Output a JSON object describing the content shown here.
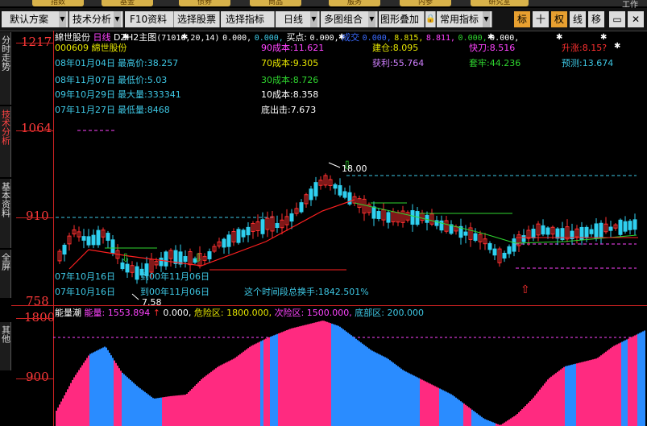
{
  "top_menu": [
    "指数",
    "基金",
    "债券",
    "商品",
    "服务",
    "内参",
    "研究室"
  ],
  "top_right_text": "工作",
  "toolbar": {
    "buttons": [
      "默认方案",
      "技术分析",
      "F10资料",
      "选择股票",
      "选择指标",
      "日线",
      "多图组合",
      "图形叠加",
      "常用指标"
    ],
    "icons": [
      "标",
      "十",
      "权",
      "线",
      "移"
    ]
  },
  "sidebar": [
    "分时走势",
    "技术分析",
    "基本资料",
    "全屏",
    "其他"
  ],
  "price_axis": {
    "labels": [
      "1217",
      "1064",
      "910",
      "758"
    ]
  },
  "vol_axis": {
    "labels": [
      "1800",
      "900"
    ]
  },
  "chart_header": {
    "stock": "綿世股份",
    "period": "日线",
    "main": "DZH2主图",
    "params": "(71016,20,14)",
    "v1": "0.000,",
    "v2": "0.000,",
    "buy_label": "买点:",
    "v3": "0.000,",
    "mid_label": "成交",
    "v4": "0.000,",
    "v5": "8.815,",
    "v6": "8.811,",
    "v7": "0.000,",
    "v8": "0.000,"
  },
  "info_left": {
    "code_name": "000609 綿世股份",
    "high_date": "08年01月04日",
    "high": "最高价:38.257",
    "low_date": "08年11月07日",
    "low": "最低价:5.03",
    "maxvol_date": "09年10月29日",
    "maxvol": "最大量:333341",
    "minvol_date": "07年11月27日",
    "minvol": "最低量:8468"
  },
  "info_mid": {
    "c90": "90成本:11.621",
    "c70": "70成本:9.305",
    "c30": "30成本:8.726",
    "c10": "10成本:8.358",
    "bottom": "底出击:7.673"
  },
  "info_right": {
    "jiancang": "建仓:8.095",
    "kuaidao": "快刀:8.516",
    "shengzhang": "升涨:8.15?",
    "huoli": "获利:55.764",
    "taolao": "套牢:44.236",
    "yuce": "预测:13.674"
  },
  "annotations": {
    "peak": "18.00",
    "low": "7.58",
    "start1": "07年10月16日",
    "end1": "到00年11月06日",
    "start2": "07年10月16日",
    "end2": "到00年11月06日",
    "turnover": "这个时间段总换手:1842.501%"
  },
  "volume_header": {
    "name": "能量潮",
    "energy": "能量: 1553.894",
    "arrow": "↑",
    "v": "0.000,",
    "danger": "危险区: 1800.000,",
    "sub_danger": "次险区: 1500.000,",
    "bottom": "底部区: 200.000"
  },
  "colors": {
    "up": "#ff3030",
    "down": "#2fd0f0",
    "vol_up": "#ff2a80",
    "vol_down": "#2a8cff",
    "axis": "#ff3a3a"
  }
}
